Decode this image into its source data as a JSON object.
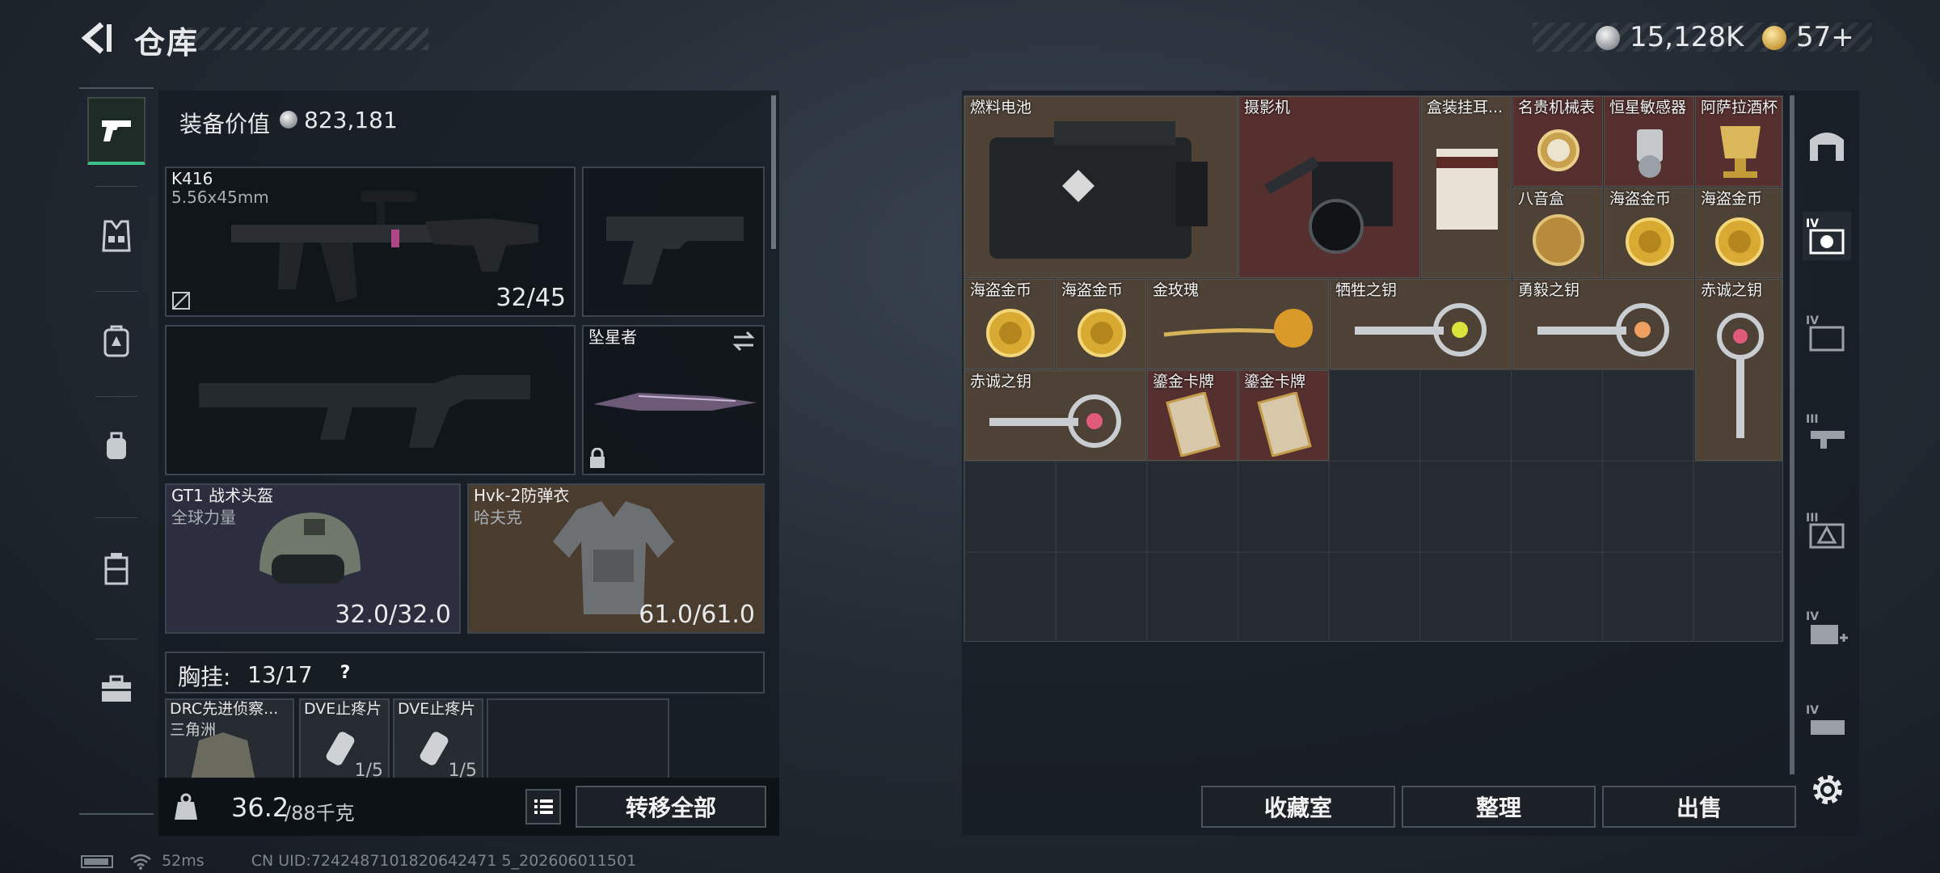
{
  "header": {
    "title": "仓库",
    "silver_amount": "15,128K",
    "gold_amount": "57+"
  },
  "equipment": {
    "value_label": "装备价值",
    "value_amount": "823,181",
    "primary_weapon": {
      "name": "K416",
      "caliber": "5.56x45mm",
      "ammo": "32/45"
    },
    "melee": {
      "name": "坠星者"
    },
    "helmet": {
      "name": "GT1 战术头盔",
      "brand": "全球力量",
      "durability": "32.0/32.0"
    },
    "armor": {
      "name": "Hvk-2防弹衣",
      "brand": "哈夫克",
      "durability": "61.0/61.0"
    },
    "chest_rig": {
      "label": "胸挂:",
      "count": "13/17",
      "help": "?",
      "items": [
        {
          "name": "DRC先进侦察...",
          "sub": "三角洲",
          "count": ""
        },
        {
          "name": "DVE止疼片",
          "sub": "",
          "count": "1/5"
        },
        {
          "name": "DVE止疼片",
          "sub": "",
          "count": "1/5"
        }
      ]
    },
    "weight_current": "36.2",
    "weight_max": "/88千克",
    "transfer_all": "转移全部"
  },
  "storage": {
    "items": [
      {
        "name": "燃料电池"
      },
      {
        "name": "摄影机"
      },
      {
        "name": "盒装挂耳..."
      },
      {
        "name": "名贵机械表"
      },
      {
        "name": "恒星敏感器"
      },
      {
        "name": "阿萨拉酒杯"
      },
      {
        "name": "八音盒"
      },
      {
        "name": "海盗金币"
      },
      {
        "name": "海盗金币"
      },
      {
        "name": "海盗金币"
      },
      {
        "name": "海盗金币"
      },
      {
        "name": "金玫瑰"
      },
      {
        "name": "牺牲之钥"
      },
      {
        "name": "勇毅之钥"
      },
      {
        "name": "赤诚之钥"
      },
      {
        "name": "赤诚之钥"
      },
      {
        "name": "鎏金卡牌"
      },
      {
        "name": "鎏金卡牌"
      }
    ],
    "buttons": {
      "collection": "收藏室",
      "sort": "整理",
      "sell": "出售"
    },
    "category_tabs": [
      "IV",
      "IV",
      "III",
      "III",
      "IV",
      "IV"
    ]
  },
  "status": {
    "ping": "52ms",
    "uid": "CN UID:7242487101820642471 5_202606011501"
  },
  "colors": {
    "accent_green": "#3fc28a",
    "item_brown": "#4e4237",
    "item_red": "#55302f"
  }
}
